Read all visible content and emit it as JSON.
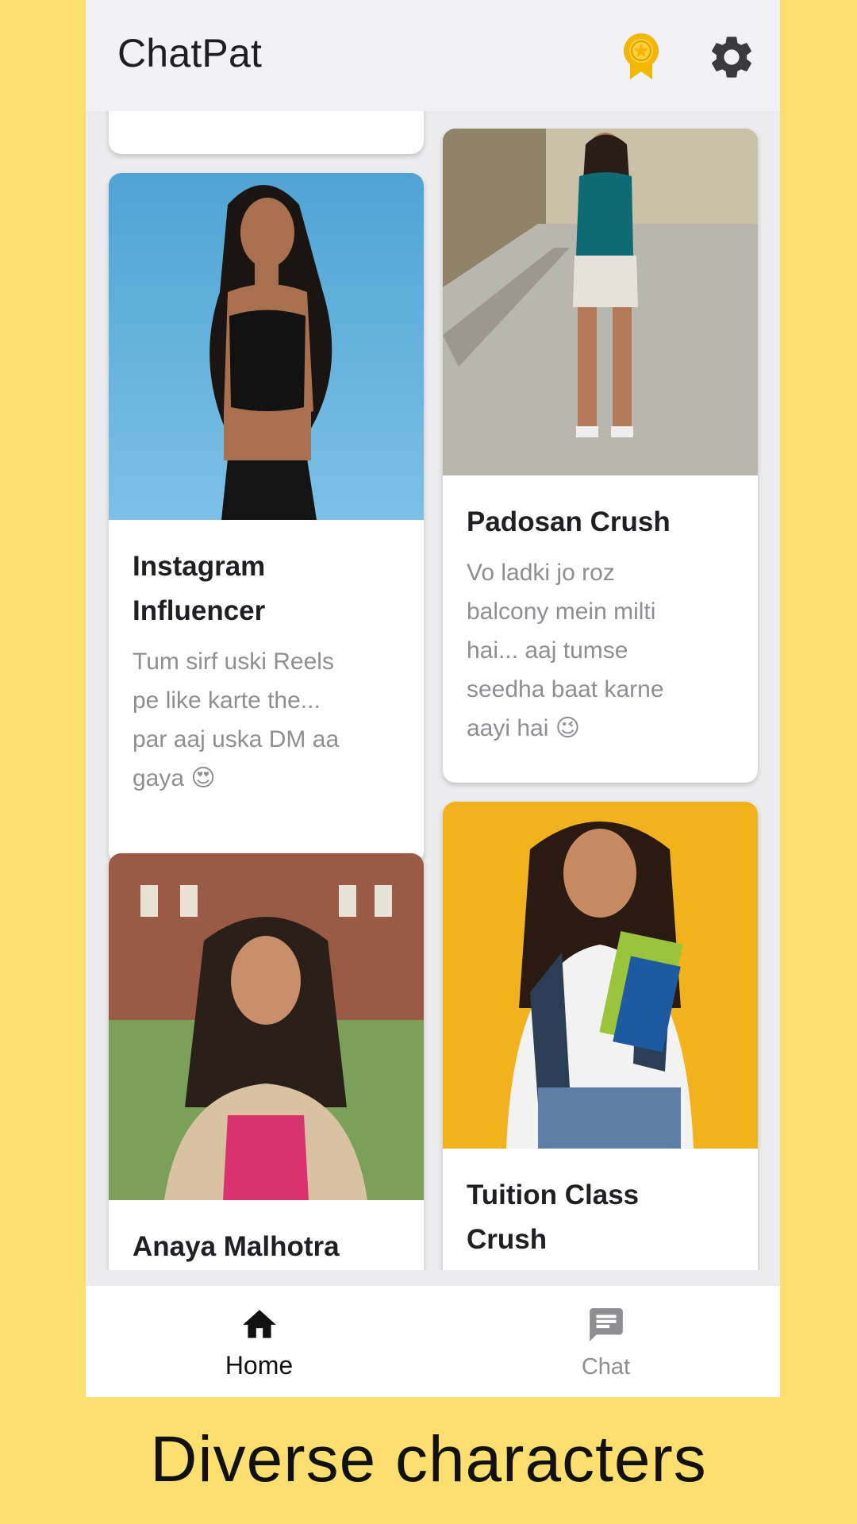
{
  "app": {
    "title": "ChatPat"
  },
  "header": {
    "award_icon": "award-badge-icon",
    "settings_icon": "gear-icon"
  },
  "cards": [
    {
      "title": "Instagram Influencer",
      "title_lines": [
        "Instagram",
        "Influencer"
      ],
      "desc_lines": [
        "Tum sirf uski Reels",
        "pe like karte the...",
        "par aaj uska DM aa",
        "gaya 😍"
      ]
    },
    {
      "title": "Padosan Crush",
      "title_lines": [
        "Padosan Crush"
      ],
      "desc_lines": [
        "Vo ladki jo roz",
        "balcony mein milti",
        "hai... aaj tumse",
        "seedha baat karne",
        "aayi hai 😉"
      ]
    },
    {
      "title": "Anaya Malhotra",
      "title_lines": [
        "Anaya Malhotra"
      ],
      "desc_lines": []
    },
    {
      "title": "Tuition Class Crush",
      "title_lines": [
        "Tuition Class",
        "Crush"
      ],
      "desc_lines": []
    }
  ],
  "nav": {
    "home": {
      "label": "Home",
      "icon": "home-icon",
      "active": true
    },
    "chat": {
      "label": "Chat",
      "icon": "chat-icon",
      "active": false
    }
  },
  "caption": "Diverse characters",
  "colors": {
    "background": "#FDDF6F",
    "appbar": "#F1F1F6",
    "award": "#F2B705",
    "active_nav": "#111111",
    "inactive_nav": "#8E8E93"
  }
}
